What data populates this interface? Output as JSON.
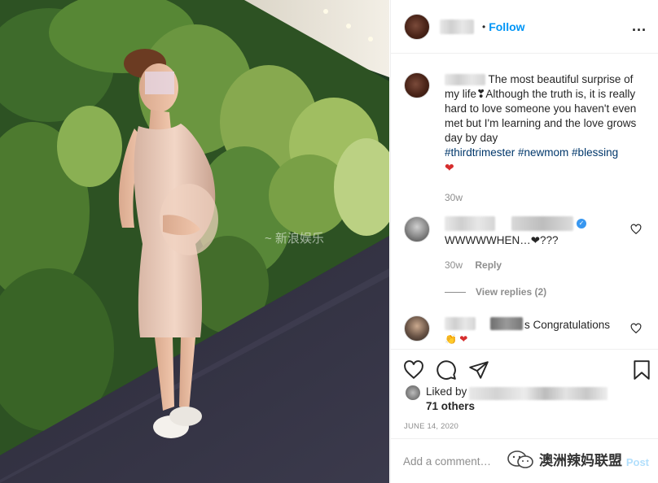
{
  "header": {
    "dot": "•",
    "follow_label": "Follow",
    "more_label": "..."
  },
  "caption": {
    "text": "The most beautiful surprise of my life❣Although the truth is, it is really hard to love someone you haven't even met but I'm learning and the love grows day by day",
    "hashtags": "#thirdtrimester #newmom #blessing",
    "emoji": "❤",
    "time": "30w"
  },
  "comments": [
    {
      "text": "WWWWWHEN…❤???",
      "time": "30w",
      "reply_label": "Reply",
      "view_replies": "View replies (2)"
    },
    {
      "text": "s Congratulations",
      "emojis": "👏 ❤"
    }
  ],
  "actions": {
    "liked_by_label": "Liked by",
    "others": "71 others",
    "date": "JUNE 14, 2020"
  },
  "add_comment": {
    "placeholder": "Add a comment…",
    "post_label": "Post"
  },
  "watermark": {
    "text": "澳洲辣妈联盟"
  },
  "colors": {
    "accent": "#0095f6",
    "hashtag": "#00376b",
    "heart": "#d62d2d",
    "muted": "#8e8e8e"
  },
  "icons": [
    "more-icon",
    "like-icon",
    "comment-icon",
    "share-icon",
    "bookmark-icon",
    "verified-icon",
    "wechat-icon"
  ]
}
